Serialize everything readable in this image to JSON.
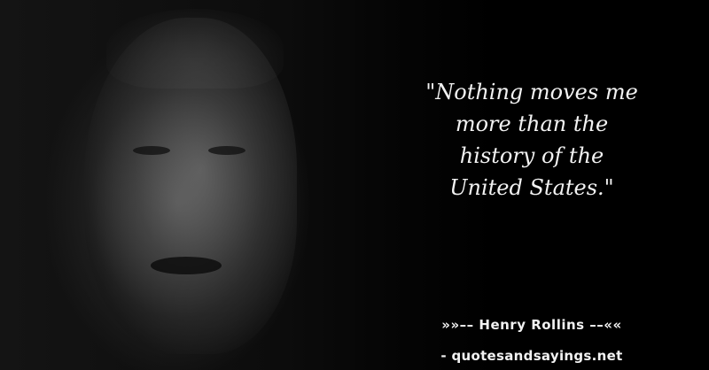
{
  "quote": {
    "lines": [
      "\"Nothing moves me",
      "more than the",
      "history of the",
      "United States.\""
    ]
  },
  "author_line": "»»–– Henry Rollins ––««",
  "source_line": "- quotesandsayings.net",
  "colors": {
    "background": "#000000",
    "text": "#f2f2f2"
  }
}
